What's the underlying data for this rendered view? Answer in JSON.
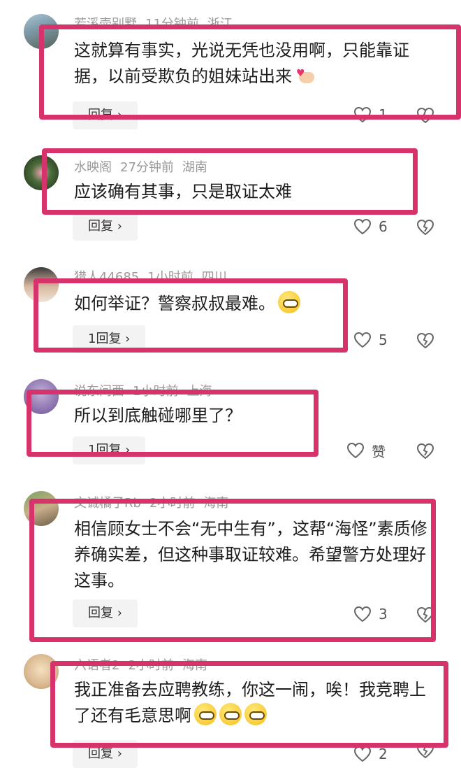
{
  "colors": {
    "frame": "#d6336c",
    "meta": "#9a9a9a",
    "reply_bg": "#f3f3f3"
  },
  "comments": [
    {
      "user": "若溪壶别墅",
      "time": "11分钟前",
      "region": "浙江",
      "text": "这就算有事实，光说无凭也没用啊，只能靠证据，以前受欺负的姐妹站出来",
      "reply": "回复 ›",
      "likes": "1",
      "avatar_icon": "landscape-avatar-icon"
    },
    {
      "user": "水映阁",
      "time": "27分钟前",
      "region": "湖南",
      "text": "应该确有其事，只是取证太难",
      "reply": "回复 ›",
      "likes": "6",
      "avatar_icon": "flower-avatar-icon"
    },
    {
      "user": "猎人44685",
      "time": "1小时前",
      "region": "四川",
      "text": "如何举证？警察叔叔最难。",
      "reply": "1回复 ›",
      "likes": "5",
      "avatar_icon": "person-avatar-icon"
    },
    {
      "user": "说东问西",
      "time": "1小时前",
      "region": "上海",
      "text": "所以到底触碰哪里了？",
      "reply": "1回复 ›",
      "likes": "赞",
      "avatar_icon": "fish-avatar-icon"
    },
    {
      "user": "文诚橘子Rb",
      "time": "2小时前",
      "region": "海南",
      "text": "相信顾女士不会“无中生有”，这帮“海怪”素质修养确实差，但这种事取证较难。希望警方处理好这事。",
      "reply": "回复 ›",
      "likes": "3",
      "avatar_icon": "outdoor-avatar-icon"
    },
    {
      "user": "六语者2",
      "time": "2小时前",
      "region": "海南",
      "text": "我正准备去应聘教练，你这一闹，唉！我竞聘上了还有毛意思啊",
      "reply": "回复 ›",
      "likes": "2",
      "avatar_icon": "cartoon-avatar-icon"
    }
  ]
}
